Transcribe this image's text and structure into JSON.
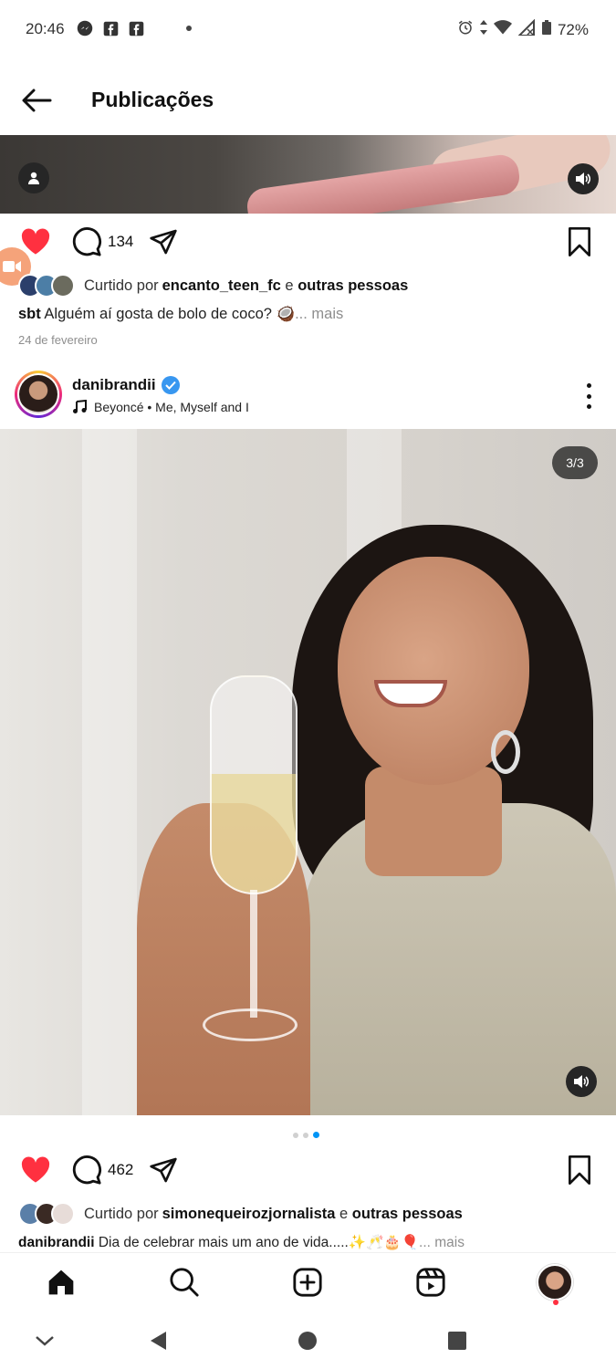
{
  "status_bar": {
    "time": "20:46",
    "battery": "72%",
    "left_icons": [
      "messenger-icon",
      "facebook-icon",
      "facebook-icon",
      "dot-icon"
    ],
    "right_icons": [
      "alarm-icon",
      "data-arrows-icon",
      "wifi-icon",
      "signal-icon",
      "battery-icon"
    ]
  },
  "header": {
    "title": "Publicações"
  },
  "post1": {
    "comment_count": "134",
    "liked_by_prefix": "Curtido por ",
    "liked_by_user": "encanto_teen_fc",
    "liked_by_joiner": " e ",
    "liked_by_others": "outras pessoas",
    "caption_user": "sbt",
    "caption_text": " Alguém aí gosta de bolo de coco? 🥥",
    "caption_more": "... mais",
    "date": "24 de fevereiro"
  },
  "post2": {
    "username": "danibrandii",
    "music": "Beyoncé • Me, Myself and I",
    "carousel_counter": "3/3",
    "carousel_total": 3,
    "carousel_active": 3,
    "comment_count": "462",
    "liked_by_prefix": "Curtido por ",
    "liked_by_user": "simonequeirozjornalista",
    "liked_by_joiner": " e ",
    "liked_by_others": "outras pessoas",
    "caption_user": "danibrandii",
    "caption_text": " Dia de celebrar mais um ano de vida.....✨🥂🎂🎈",
    "caption_more": "... mais"
  },
  "colors": {
    "like_red": "#ff3040",
    "verified_blue": "#3897f0",
    "active_dot": "#0095f6",
    "muted_text": "#8e8e8e"
  }
}
